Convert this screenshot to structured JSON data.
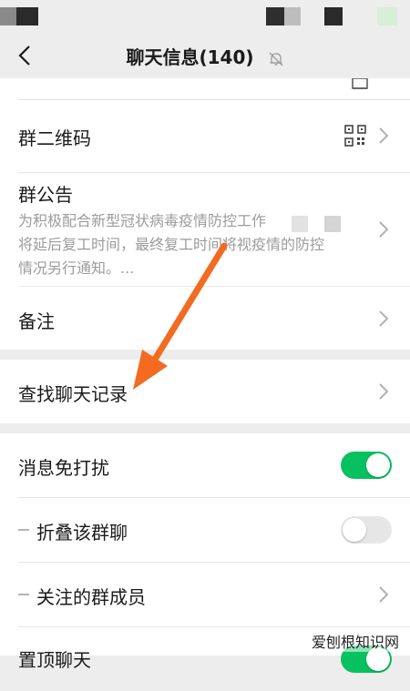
{
  "header": {
    "title": "聊天信息(140)"
  },
  "rows": {
    "qr": {
      "label": "群二维码"
    },
    "notice": {
      "label": "群公告",
      "lines": [
        "为积极配合新型冠状病毒疫情防控工作",
        "将延后复工时间，最终复工时间将视疫情的防控",
        "情况另行通知。..."
      ]
    },
    "remark": {
      "label": "备注"
    },
    "search_history": {
      "label": "查找聊天记录"
    },
    "mute": {
      "label": "消息免打扰",
      "enabled": true
    },
    "fold": {
      "label": "折叠该群聊",
      "enabled": false
    },
    "followed": {
      "label": "关注的群成员"
    },
    "pin": {
      "label": "置顶聊天",
      "enabled": true
    }
  },
  "watermark": {
    "text": "爱刨根知识网"
  },
  "colors": {
    "accent": "#07c160",
    "annotation_arrow": "#f26b21"
  }
}
